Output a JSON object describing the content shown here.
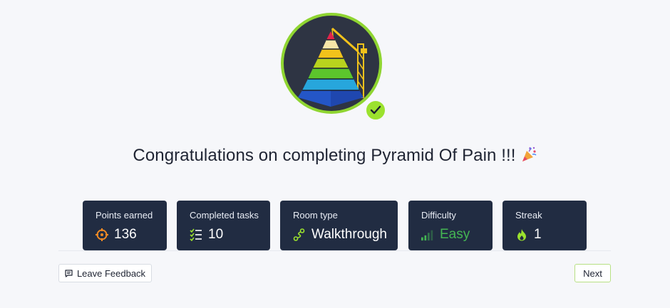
{
  "title": "Congratulations on completing Pyramid Of Pain !!!",
  "stats": {
    "points": {
      "label": "Points earned",
      "value": "136"
    },
    "tasks": {
      "label": "Completed tasks",
      "value": "10"
    },
    "room_type": {
      "label": "Room type",
      "value": "Walkthrough"
    },
    "difficulty": {
      "label": "Difficulty",
      "value": "Easy"
    },
    "streak": {
      "label": "Streak",
      "value": "1"
    }
  },
  "buttons": {
    "feedback": "Leave Feedback",
    "next": "Next"
  },
  "colors": {
    "card_bg": "#212c42",
    "accent_green": "#9be22e",
    "difficulty_green": "#44b653",
    "points_orange": "#f08a24"
  },
  "icons": [
    "pyramid-badge-icon",
    "checkmark-icon",
    "party-popper-icon",
    "target-icon",
    "tasks-checklist-icon",
    "route-icon",
    "signal-bars-icon",
    "flame-icon",
    "feedback-icon"
  ]
}
